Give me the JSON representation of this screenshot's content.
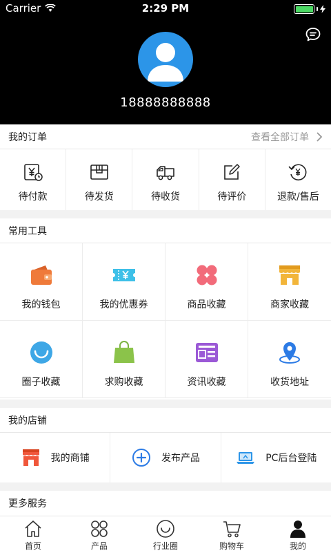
{
  "status_bar": {
    "carrier": "Carrier",
    "time": "2:29 PM",
    "battery_level": 1.0
  },
  "profile": {
    "phone": "18888888888"
  },
  "orders": {
    "title": "我的订单",
    "view_all": "查看全部订单",
    "items": [
      {
        "label": "待付款",
        "icon": "wallet-yen-icon"
      },
      {
        "label": "待发货",
        "icon": "package-icon"
      },
      {
        "label": "待收货",
        "icon": "truck-icon"
      },
      {
        "label": "待评价",
        "icon": "pen-icon"
      },
      {
        "label": "退款/售后",
        "icon": "refund-icon"
      }
    ]
  },
  "tools": {
    "title": "常用工具",
    "items": [
      {
        "label": "我的钱包",
        "icon": "wallet-icon"
      },
      {
        "label": "我的优惠券",
        "icon": "coupon-icon"
      },
      {
        "label": "商品收藏",
        "icon": "clover-icon"
      },
      {
        "label": "商家收藏",
        "icon": "store-icon"
      },
      {
        "label": "圈子收藏",
        "icon": "smile-circle-icon"
      },
      {
        "label": "求购收藏",
        "icon": "shopping-bag-icon"
      },
      {
        "label": "资讯收藏",
        "icon": "news-icon"
      },
      {
        "label": "收货地址",
        "icon": "location-pin-icon"
      }
    ]
  },
  "shop": {
    "title": "我的店铺",
    "items": [
      {
        "label": "我的商铺",
        "icon": "shop-icon"
      },
      {
        "label": "发布产品",
        "icon": "plus-circle-icon"
      },
      {
        "label": "PC后台登陆",
        "icon": "laptop-icon"
      }
    ]
  },
  "more": {
    "title": "更多服务"
  },
  "tabbar": {
    "items": [
      {
        "label": "首页",
        "icon": "home-icon"
      },
      {
        "label": "产品",
        "icon": "grid-icon"
      },
      {
        "label": "行业圈",
        "icon": "smile-icon"
      },
      {
        "label": "购物车",
        "icon": "cart-icon"
      },
      {
        "label": "我的",
        "icon": "user-icon",
        "active": true
      }
    ]
  },
  "colors": {
    "accent_blue": "#2c95e8",
    "wallet_orange": "#ef7a3a",
    "coupon_cyan": "#3ec0e8",
    "clover_pink": "#f26b7a",
    "store_yellow": "#f2b53a",
    "bag_green": "#8bc34a",
    "news_purple": "#9b59d6",
    "shop_red": "#f0573b"
  }
}
